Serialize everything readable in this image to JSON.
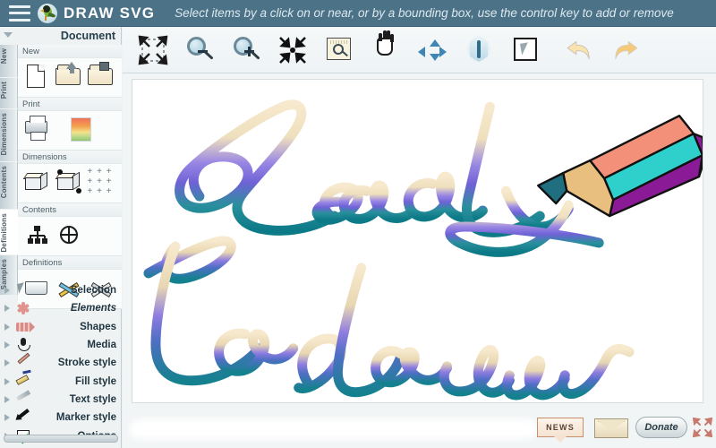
{
  "header": {
    "menu_icon": "hamburger-menu-icon",
    "logo_icon": "drawsvg-bird-logo",
    "brand": "DRAW SVG",
    "hint": "Select items by a click on or near, or by a bounding box, use the control key to add or remove",
    "bg_color": "#4c7287"
  },
  "sidebar": {
    "panel_title": "Document",
    "collapse_icon": "caret-down-icon",
    "vertical_tabs": [
      {
        "label": "New",
        "active": false
      },
      {
        "label": "Print",
        "active": false
      },
      {
        "label": "Dimensions",
        "active": false
      },
      {
        "label": "Contents",
        "active": false
      },
      {
        "label": "Definitions",
        "active": true
      },
      {
        "label": "Samples",
        "active": false
      }
    ],
    "groups": [
      {
        "label": "New",
        "tools": [
          {
            "name": "new-document-icon"
          },
          {
            "name": "open-file-icon"
          },
          {
            "name": "save-file-icon"
          }
        ]
      },
      {
        "label": "Print",
        "tools": [
          {
            "name": "print-icon"
          },
          {
            "name": "export-image-icon"
          }
        ]
      },
      {
        "label": "Dimensions",
        "tools": [
          {
            "name": "canvas-size-icon"
          },
          {
            "name": "resize-handles-icon"
          },
          {
            "name": "alignment-grid-icon"
          }
        ]
      },
      {
        "label": "Contents",
        "tools": [
          {
            "name": "structure-tree-icon"
          },
          {
            "name": "globe-icon"
          }
        ]
      },
      {
        "label": "Definitions",
        "tools": [
          {
            "name": "inbox-tray-icon"
          },
          {
            "name": "color-tools-icon"
          },
          {
            "name": "grey-tools-icon"
          }
        ]
      }
    ],
    "accordion": [
      {
        "label": "Selection",
        "icon": "cursor-arrow-icon",
        "italic": false
      },
      {
        "label": "Elements",
        "icon": "flower-shape-icon",
        "italic": true
      },
      {
        "label": "Shapes",
        "icon": "shapes-icon",
        "italic": false
      },
      {
        "label": "Media",
        "icon": "microphone-icon",
        "italic": false
      },
      {
        "label": "Stroke style",
        "icon": "pencil-icon",
        "italic": false
      },
      {
        "label": "Fill style",
        "icon": "paint-roller-icon",
        "italic": false
      },
      {
        "label": "Text style",
        "icon": "quill-pen-icon",
        "italic": false
      },
      {
        "label": "Marker style",
        "icon": "marker-arrow-icon",
        "italic": false
      },
      {
        "label": "Options",
        "icon": "checkbox-icon",
        "italic": false
      }
    ]
  },
  "toolbar": {
    "buttons": [
      {
        "name": "fit-to-screen-button",
        "icon": "expand-arrows-icon"
      },
      {
        "name": "zoom-out-button",
        "icon": "magnifier-minus-icon"
      },
      {
        "name": "zoom-in-button",
        "icon": "magnifier-plus-icon"
      },
      {
        "name": "zoom-to-point-button",
        "icon": "collapse-arrows-icon"
      },
      {
        "name": "zoom-area-button",
        "icon": "magnifier-box-icon"
      },
      {
        "name": "pan-button",
        "icon": "hand-icon"
      },
      {
        "name": "move-button",
        "icon": "four-way-arrows-icon"
      },
      {
        "name": "flip-vertical-button",
        "icon": "flip-vertical-icon"
      },
      {
        "name": "select-button",
        "icon": "select-pointer-icon"
      },
      {
        "name": "undo-button",
        "icon": "undo-arrow-icon"
      },
      {
        "name": "redo-button",
        "icon": "redo-arrow-icon"
      }
    ]
  },
  "canvas": {
    "artwork_text": "Ready to draw",
    "artwork_type": "handwritten-script-gradient",
    "gradient_stops": [
      "#f6e6c8",
      "#8f7fe0",
      "#6f5fd6",
      "#1f8a96",
      "#0f7b86"
    ],
    "pencil": {
      "name": "pencil-illustration",
      "body_top_color": "#f2907a",
      "body_mid_color": "#2fd0cc",
      "body_bottom_color": "#8a1a96",
      "wood_color": "#e8bf7e",
      "tip_color": "#1f6f80",
      "outline_color": "#111111"
    },
    "background": "#ffffff"
  },
  "bottom_bar": {
    "news_label": "NEWS",
    "mail_icon": "envelope-icon",
    "donate_label": "Donate",
    "fullscreen_icon": "fullscreen-expand-icon"
  }
}
